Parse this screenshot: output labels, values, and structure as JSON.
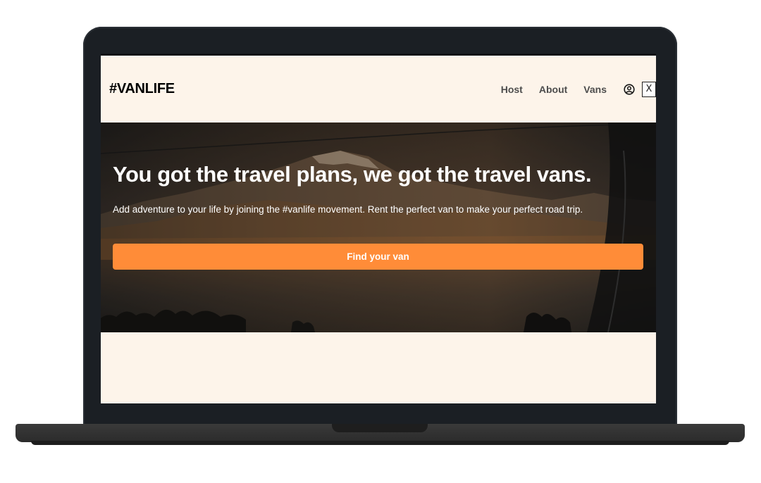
{
  "site": {
    "logo": "#VANLIFE"
  },
  "nav": {
    "items": [
      {
        "label": "Host"
      },
      {
        "label": "About"
      },
      {
        "label": "Vans"
      }
    ],
    "user_icon": "user-circle-icon",
    "close_label": "X"
  },
  "hero": {
    "title": "You got the travel plans, we got the travel vans.",
    "subtitle": "Add adventure to your life by joining the #vanlife movement. Rent the perfect van to make your perfect road trip.",
    "cta_label": "Find your van"
  },
  "colors": {
    "page_bg": "#fdf4ea",
    "accent": "#ff8c38",
    "laptop_frame": "#1b1f24"
  }
}
